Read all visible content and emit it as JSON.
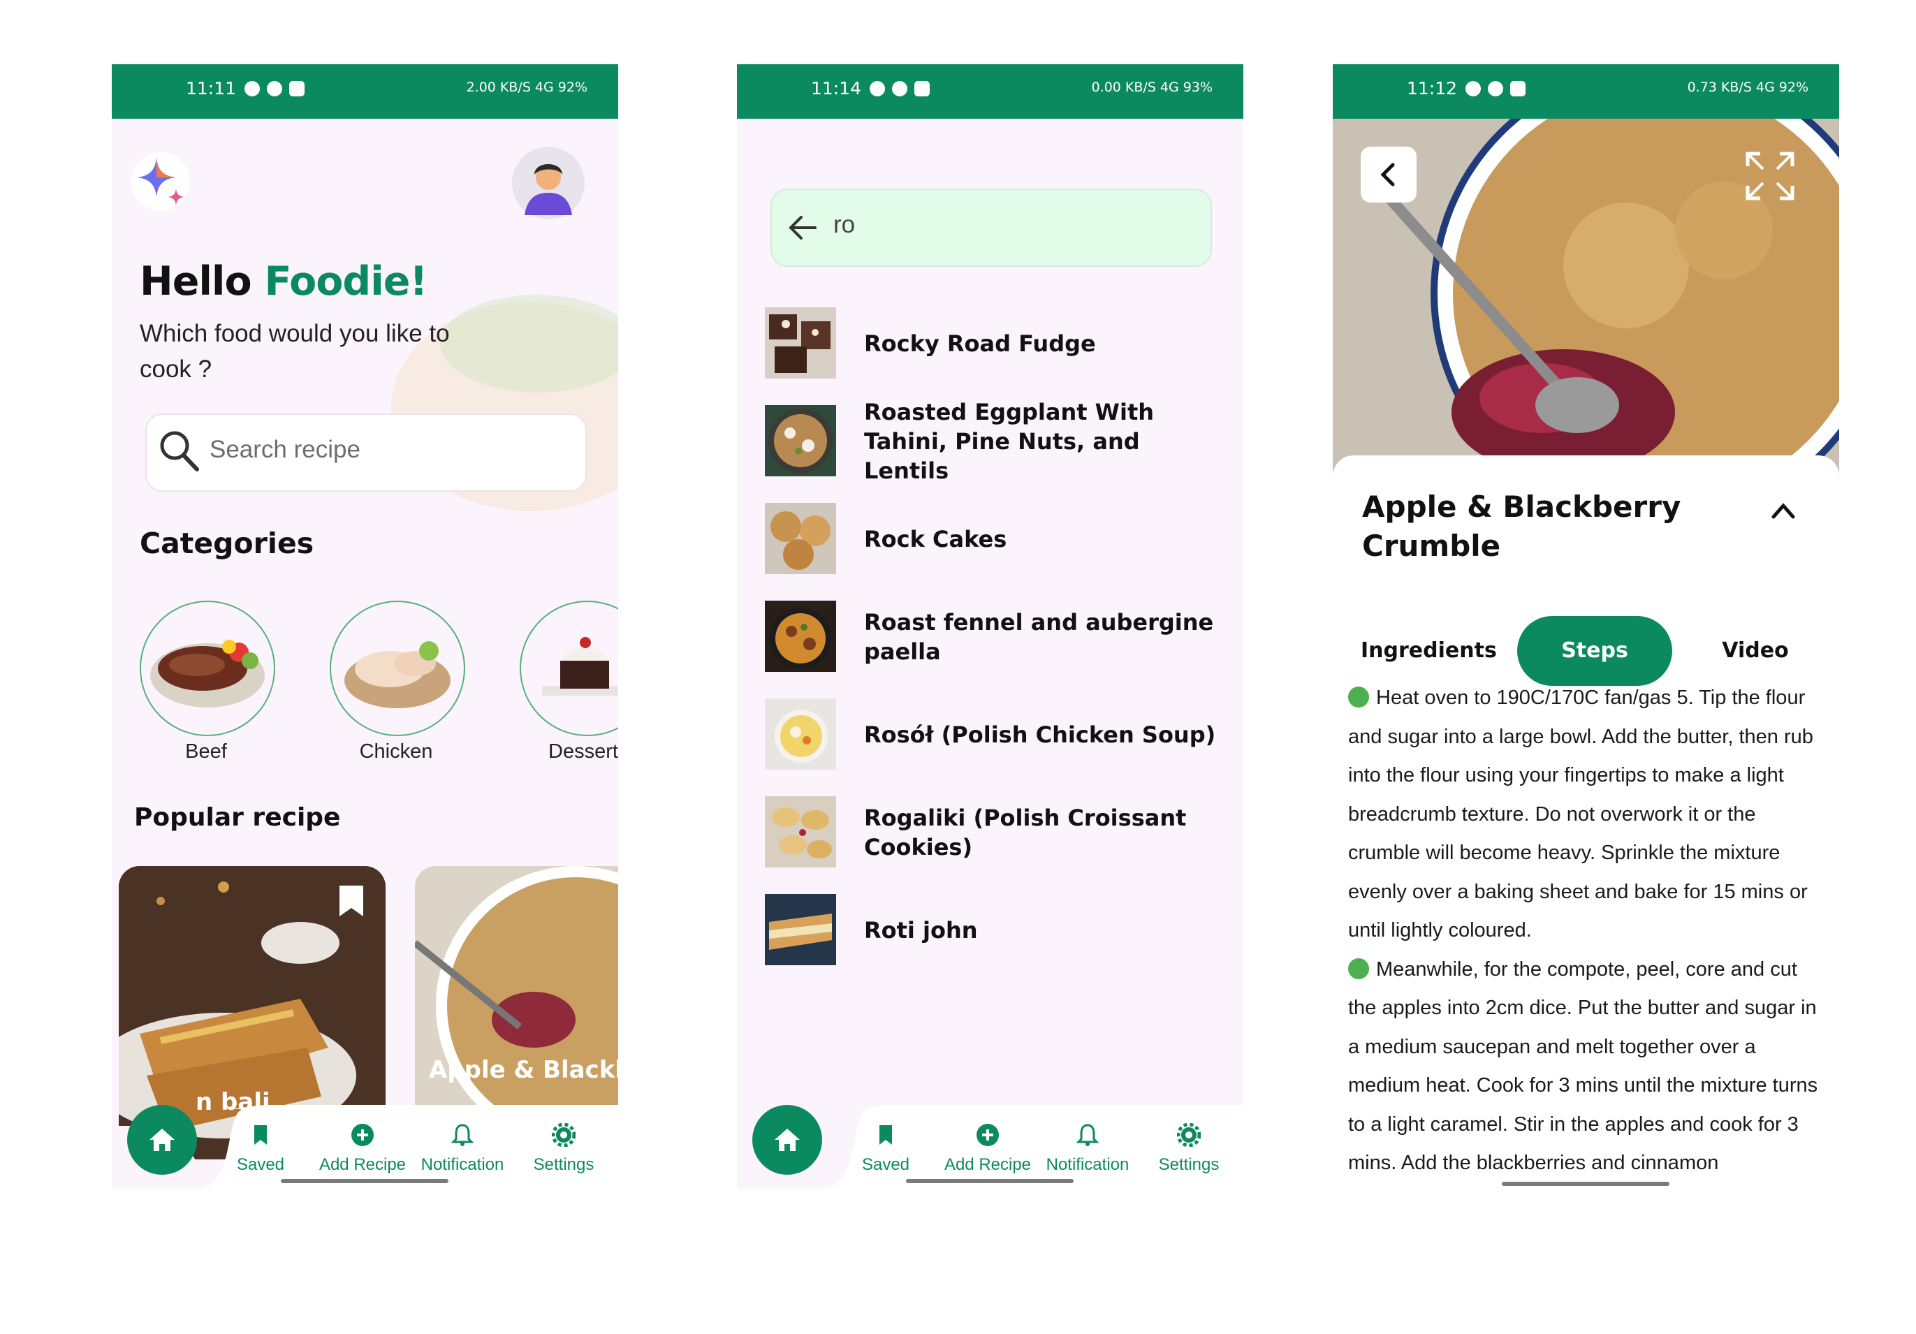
{
  "home": {
    "status_time": "11:11",
    "status_right": "2.00 KB/S  4G  92%",
    "greeting_hello": "Hello",
    "greeting_name": "Foodie!",
    "subtitle": "Which food would you like to cook ?",
    "search_placeholder": "Search recipe",
    "categories_title": "Categories",
    "categories": [
      {
        "label": "Beef"
      },
      {
        "label": "Chicken"
      },
      {
        "label": "Dessert"
      }
    ],
    "popular_title": "Popular recipe",
    "popular": [
      {
        "title": "n bali"
      },
      {
        "title": "Apple & Blackb"
      }
    ]
  },
  "search": {
    "status_time": "11:14",
    "status_right": "0.00 KB/S  4G  93%",
    "query": "ro",
    "results": [
      {
        "title": "Rocky Road Fudge"
      },
      {
        "title": "Roasted Eggplant With Tahini, Pine Nuts, and Lentils"
      },
      {
        "title": "Rock Cakes"
      },
      {
        "title": "Roast fennel and aubergine paella"
      },
      {
        "title": "Rosół (Polish Chicken Soup)"
      },
      {
        "title": "Rogaliki (Polish Croissant Cookies)"
      },
      {
        "title": "Roti john"
      }
    ]
  },
  "detail": {
    "status_time": "11:12",
    "status_right": "0.73 KB/S  4G  92%",
    "title": "Apple & Blackberry Crumble",
    "tabs": [
      {
        "label": "Ingredients"
      },
      {
        "label": "Steps"
      },
      {
        "label": "Video"
      }
    ],
    "active_tab": "Steps",
    "steps": [
      "Heat oven to 190C/170C fan/gas 5. Tip the flour and sugar into a large bowl. Add the butter, then rub into the flour using your fingertips to make a light breadcrumb texture. Do not overwork it or the crumble will become heavy. Sprinkle the mixture evenly over a baking sheet and bake for 15 mins or until lightly coloured.",
      "Meanwhile, for the compote, peel, core and cut the apples into 2cm dice. Put the butter and sugar in a medium saucepan and melt together over a medium heat. Cook for 3 mins until the mixture turns to a light caramel. Stir in the apples and cook for 3 mins. Add the blackberries and cinnamon"
    ]
  },
  "nav": {
    "items": [
      {
        "label": "Saved"
      },
      {
        "label": "Add Recipe"
      },
      {
        "label": "Notification"
      },
      {
        "label": "Settings"
      }
    ]
  },
  "colors": {
    "primary": "#0c8a5f",
    "background": "#fcf4fc",
    "search_bg": "#e3fbe9",
    "step_dot": "#4caf50"
  }
}
